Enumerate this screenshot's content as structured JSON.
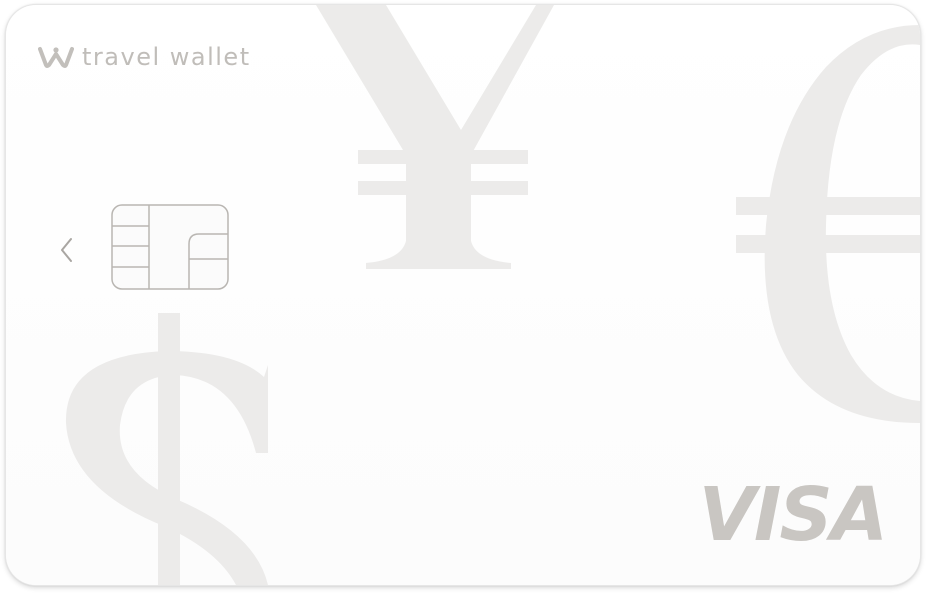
{
  "card": {
    "brand_name": "travel wallet",
    "network_label": "VISA",
    "background_symbols": [
      "¥",
      "€",
      "$"
    ],
    "icons": {
      "logo": "travel-wallet-w-logo",
      "chevron": "chevron-left-icon",
      "chip": "emv-chip-icon"
    },
    "colors": {
      "card_background": "#fdfdfd",
      "symbol_fill": "#ecebea",
      "brand_text": "#c0bdb9",
      "network_text": "#c9c6c2",
      "chip_stroke": "#b9b6b2"
    }
  }
}
